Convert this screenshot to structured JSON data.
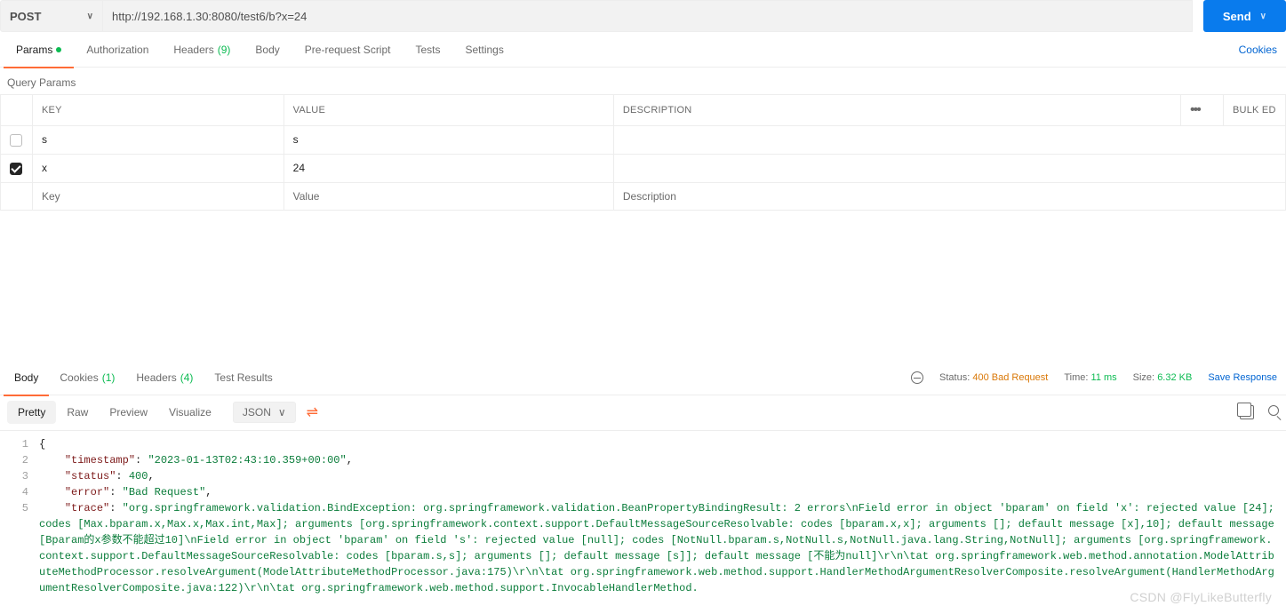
{
  "request": {
    "method": "POST",
    "url": "http://192.168.1.30:8080/test6/b?x=24",
    "send_label": "Send"
  },
  "tabs": {
    "params": "Params",
    "authorization": "Authorization",
    "headers": "Headers",
    "headers_count": "(9)",
    "body": "Body",
    "prerequest": "Pre-request Script",
    "tests": "Tests",
    "settings": "Settings",
    "cookies_link": "Cookies"
  },
  "query_params": {
    "section_label": "Query Params",
    "columns": {
      "key": "KEY",
      "value": "VALUE",
      "description": "DESCRIPTION"
    },
    "bulk_edit": "Bulk Ed",
    "rows": [
      {
        "enabled": false,
        "key": "s",
        "value": "s",
        "description": ""
      },
      {
        "enabled": true,
        "key": "x",
        "value": "24",
        "description": ""
      }
    ],
    "placeholders": {
      "key": "Key",
      "value": "Value",
      "description": "Description"
    }
  },
  "response": {
    "tabs": {
      "body": "Body",
      "cookies": "Cookies",
      "cookies_count": "(1)",
      "headers": "Headers",
      "headers_count": "(4)",
      "test_results": "Test Results"
    },
    "meta": {
      "status_label": "Status:",
      "status_value": "400 Bad Request",
      "time_label": "Time:",
      "time_value": "11 ms",
      "size_label": "Size:",
      "size_value": "6.32 KB",
      "save_label": "Save Response"
    },
    "view": {
      "pretty": "Pretty",
      "raw": "Raw",
      "preview": "Preview",
      "visualize": "Visualize",
      "lang": "JSON"
    },
    "json": {
      "timestamp": "2023-01-13T02:43:10.359+00:00",
      "status": 400,
      "error": "Bad Request",
      "trace": "org.springframework.validation.BindException: org.springframework.validation.BeanPropertyBindingResult: 2 errors\\nField error in object 'bparam' on field 'x': rejected value [24]; codes [Max.bparam.x,Max.x,Max.int,Max]; arguments [org.springframework.context.support.DefaultMessageSourceResolvable: codes [bparam.x,x]; arguments []; default message [x],10]; default message [Bparam的x参数不能超过10]\\nField error in object 'bparam' on field 's': rejected value [null]; codes [NotNull.bparam.s,NotNull.s,NotNull.java.lang.String,NotNull]; arguments [org.springframework.context.support.DefaultMessageSourceResolvable: codes [bparam.s,s]; arguments []; default message [s]]; default message [不能为null]\\r\\n\\tat org.springframework.web.method.annotation.ModelAttributeMethodProcessor.resolveArgument(ModelAttributeMethodProcessor.java:175)\\r\\n\\tat org.springframework.web.method.support.HandlerMethodArgumentResolverComposite.resolveArgument(HandlerMethodArgumentResolverComposite.java:122)\\r\\n\\tat org.springframework.web.method.support.InvocableHandlerMethod."
    }
  },
  "watermark": "CSDN @FlyLikeButterfly"
}
